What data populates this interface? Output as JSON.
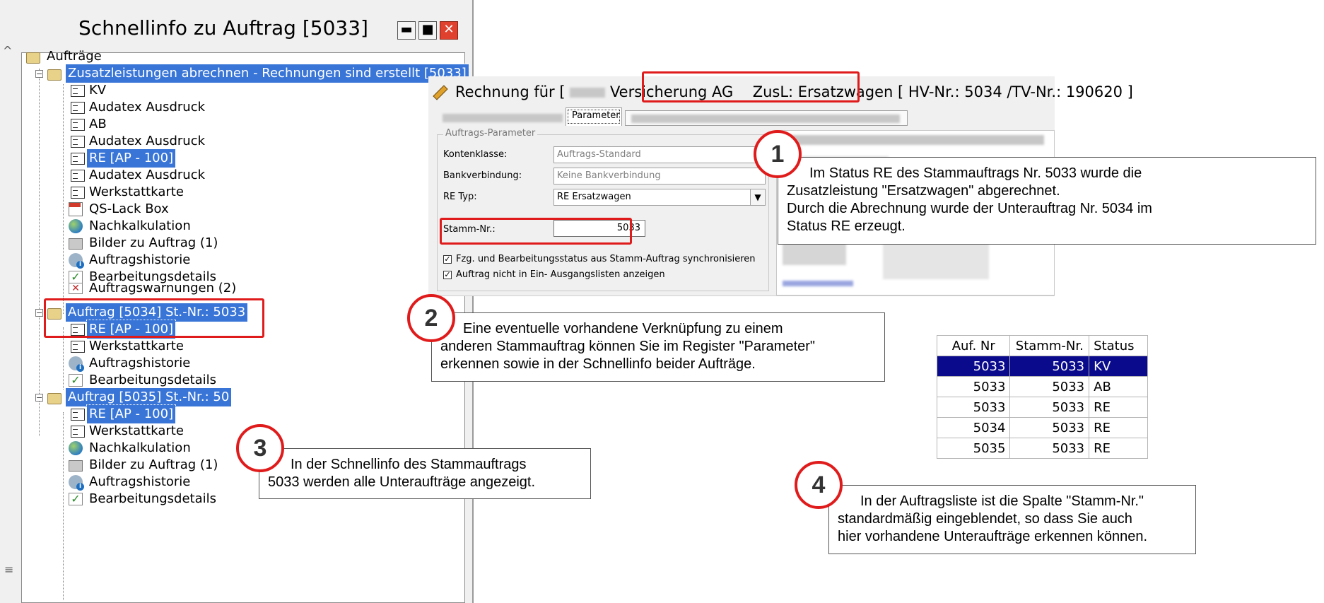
{
  "window": {
    "title": "Schnellinfo zu Auftrag [5033]",
    "buttons": {
      "minimize": "▬",
      "maximize": "■",
      "close": "✕"
    }
  },
  "tree": {
    "root": "Aufträge",
    "order_5033": {
      "label": "Zusatzleistungen abrechnen - Rechnungen sind erstellt [5033]",
      "children": [
        "KV",
        "Audatex Ausdruck",
        "AB",
        "Audatex Ausdruck",
        "RE [AP - 100]",
        "Audatex Ausdruck",
        "Werkstattkarte",
        "QS-Lack Box",
        "Nachkalkulation",
        "Bilder zu Auftrag (1)",
        "Auftragshistorie",
        "Bearbeitungsdetails",
        "Auftragswarnungen (2)"
      ]
    },
    "order_5034": {
      "label": "Auftrag [5034] St.-Nr.: 5033",
      "children": [
        "RE [AP - 100]",
        "Werkstattkarte",
        "Auftragshistorie",
        "Bearbeitungsdetails"
      ]
    },
    "order_5035": {
      "label": "Auftrag [5035] St.-Nr.: 50",
      "children": [
        "RE [AP - 100]",
        "Werkstattkarte",
        "Nachkalkulation",
        "Bilder zu Auftrag (1)",
        "Auftragshistorie",
        "Bearbeitungsdetails"
      ]
    }
  },
  "dialog": {
    "title_prefix": "Rechnung  für [",
    "title_insurer": "Versicherung AG",
    "title_zusl": "ZusL: Ersatzwagen [ HV-Nr.: 5034 /",
    "title_tv": "TV-Nr.: 190620 ]",
    "tab_parameter": "Parameter",
    "group_title": "Auftrags-Parameter",
    "fields": {
      "kontenklasse_label": "Kontenklasse:",
      "kontenklasse_value": "Auftrags-Standard",
      "bank_label": "Bankverbindung:",
      "bank_value": "Keine Bankverbindung",
      "retyp_label": "RE Typ:",
      "retyp_value": "RE Ersatzwagen",
      "stamm_label": "Stamm-Nr.:",
      "stamm_value": "5033"
    },
    "checkboxes": [
      "Fzg. und Bearbeitungsstatus aus Stamm-Auftrag synchronisieren",
      "Auftrag nicht in Ein- Ausgangslisten anzeigen"
    ]
  },
  "callouts": [
    {
      "number": "1",
      "lines": [
        "Im Status RE des Stammauftrags Nr. 5033 wurde die",
        "Zusatzleistung \"Ersatzwagen\" abgerechnet.",
        "Durch die Abrechnung wurde der Unterauftrag Nr. 5034 im",
        "Status RE erzeugt."
      ]
    },
    {
      "number": "2",
      "lines": [
        "Eine eventuelle vorhandene Verknüpfung zu einem",
        "anderen Stammauftrag können Sie im Register \"Parameter\"",
        "erkennen sowie in der Schnellinfo beider Aufträge."
      ]
    },
    {
      "number": "3",
      "lines": [
        "In der Schnellinfo des Stammauftrags",
        "5033 werden alle Unteraufträge angezeigt."
      ]
    },
    {
      "number": "4",
      "lines": [
        "In der Auftragsliste ist die Spalte \"Stamm-Nr.\"",
        "standardmäßig eingeblendet, so dass Sie auch",
        "hier vorhandene Unteraufträge erkennen können."
      ]
    }
  ],
  "order_list": {
    "headers": [
      "Auf. Nr",
      "Stamm-Nr.",
      "Status"
    ],
    "rows": [
      [
        "5033",
        "5033",
        "KV"
      ],
      [
        "5033",
        "5033",
        "AB"
      ],
      [
        "5033",
        "5033",
        "RE"
      ],
      [
        "5034",
        "5033",
        "RE"
      ],
      [
        "5035",
        "5033",
        "RE"
      ]
    ]
  },
  "colors": {
    "selection": "#3875d7",
    "highlight_red": "#e01b1b",
    "list_selected": "#0a0a8c"
  },
  "icons": {
    "tree": [
      "folder-icon",
      "document-icon",
      "sphere-icon",
      "info-icon",
      "checklist-icon",
      "warning-icon",
      "box-icon",
      "image-icon"
    ],
    "dialog": "pencil-icon"
  }
}
